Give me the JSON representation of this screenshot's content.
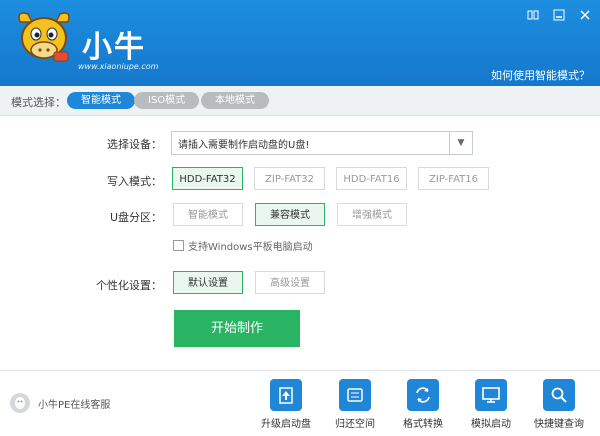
{
  "header": {
    "brand": "小牛",
    "url": "www.xiaoniupe.com",
    "help": "如何使用智能模式？"
  },
  "modebar": {
    "label": "模式选择：",
    "modes": [
      "智能模式",
      "ISO模式",
      "本地模式"
    ],
    "active": "智能模式"
  },
  "form": {
    "device_label": "选择设备：",
    "device_value": "请插入需要制作启动盘的U盘!",
    "write_label": "写入模式：",
    "write_options": [
      "HDD-FAT32",
      "ZIP-FAT32",
      "HDD-FAT16",
      "ZIP-FAT16"
    ],
    "write_selected": "HDD-FAT32",
    "partition_label": "U盘分区：",
    "partition_options": [
      "智能模式",
      "兼容模式",
      "增强模式"
    ],
    "partition_selected": "兼容模式",
    "checkbox_label": "支持Windows平板电脑启动",
    "personal_label": "个性化设置：",
    "personal_options": [
      "默认设置",
      "高级设置"
    ],
    "personal_selected": "默认设置",
    "start_button": "开始制作"
  },
  "footer": {
    "support": "小牛PE在线客服",
    "tools": [
      "升级启动盘",
      "归还空间",
      "格式转换",
      "模拟启动",
      "快捷键查询"
    ]
  },
  "colors": {
    "header_blue": "#1d8ee0",
    "active_blue": "#1d87db",
    "green": "#28b463"
  }
}
